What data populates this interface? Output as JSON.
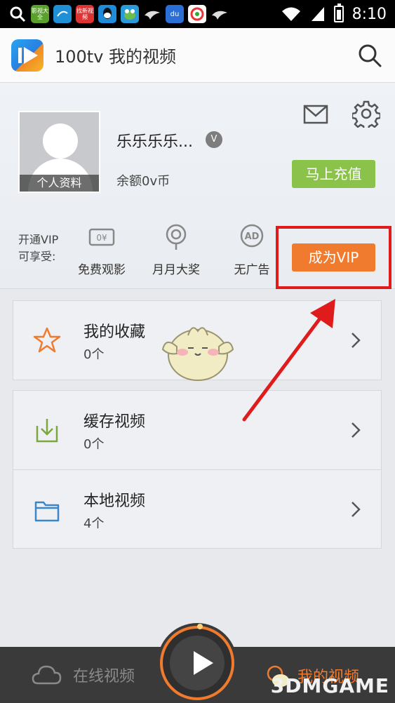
{
  "status_bar": {
    "time": "8:10",
    "icons": [
      "影视大全-icon",
      "app-icon",
      "找新视频-icon",
      "qq-icon",
      "frog-icon",
      "bird-icon",
      "baidu-icon",
      "browser-icon",
      "bird-icon"
    ],
    "app_icon_labels": [
      "影视大全",
      "找新视频"
    ]
  },
  "appbar": {
    "title": "100tv 我的视频"
  },
  "profile": {
    "avatar_label": "个人资料",
    "username": "乐乐乐乐...",
    "vip_badge": "V",
    "balance": "余额0v币",
    "recharge_label": "马上充值"
  },
  "vip": {
    "lead_line1": "开通VIP",
    "lead_line2": "可享受:",
    "perks": [
      {
        "label": "免费观影",
        "icon": "ticket-icon",
        "icon_text": "0¥"
      },
      {
        "label": "月月大奖",
        "icon": "prize-icon"
      },
      {
        "label": "无广告",
        "icon": "no-ad-icon",
        "icon_text": "AD"
      }
    ],
    "cta_label": "成为VIP"
  },
  "lists": {
    "favorites": {
      "title": "我的收藏",
      "count": "0个",
      "icon": "star-icon"
    },
    "cached": {
      "title": "缓存视频",
      "count": "0个",
      "icon": "download-icon"
    },
    "local": {
      "title": "本地视频",
      "count": "4个",
      "icon": "folder-icon"
    }
  },
  "tabbar": {
    "online_label": "在线视频",
    "mine_label": "我的视频"
  },
  "watermark": "3DMGAME",
  "colors": {
    "accent_orange": "#f07b2e",
    "recharge_green": "#8ac24a",
    "annotation_red": "#e01b1b"
  }
}
